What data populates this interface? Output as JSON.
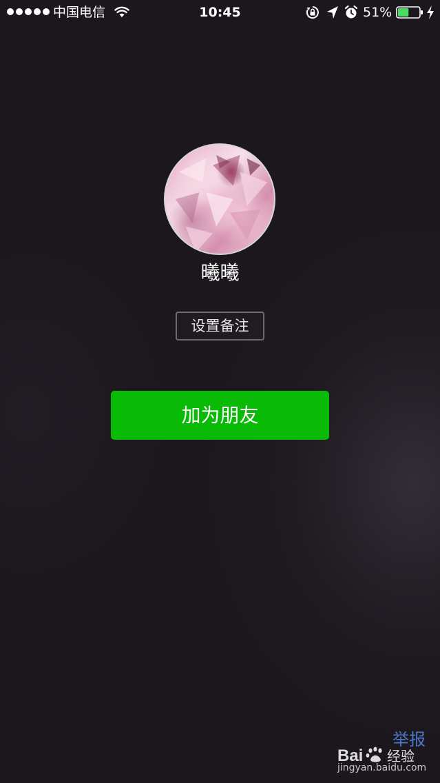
{
  "status_bar": {
    "carrier": "中国电信",
    "time": "10:45",
    "battery_percent": "51%",
    "battery_level": 0.51,
    "icons": [
      "signal-dots",
      "wifi-icon",
      "rotation-lock-icon",
      "location-icon",
      "alarm-icon",
      "battery-icon",
      "charging-bolt-icon"
    ]
  },
  "profile": {
    "nickname": "曦曦",
    "avatar_icon": "avatar-image"
  },
  "actions": {
    "set_remark_label": "设置备注",
    "add_friend_label": "加为朋友"
  },
  "colors": {
    "background": "#1b171d",
    "primary_green": "#09bb07",
    "remark_border": "#6e6a70",
    "watermark_blue": "#4d78c8"
  },
  "watermark": {
    "report_label": "举报",
    "brand": "Bai",
    "brand_suffix": "经验",
    "url": "jingyan.baidu.com"
  }
}
